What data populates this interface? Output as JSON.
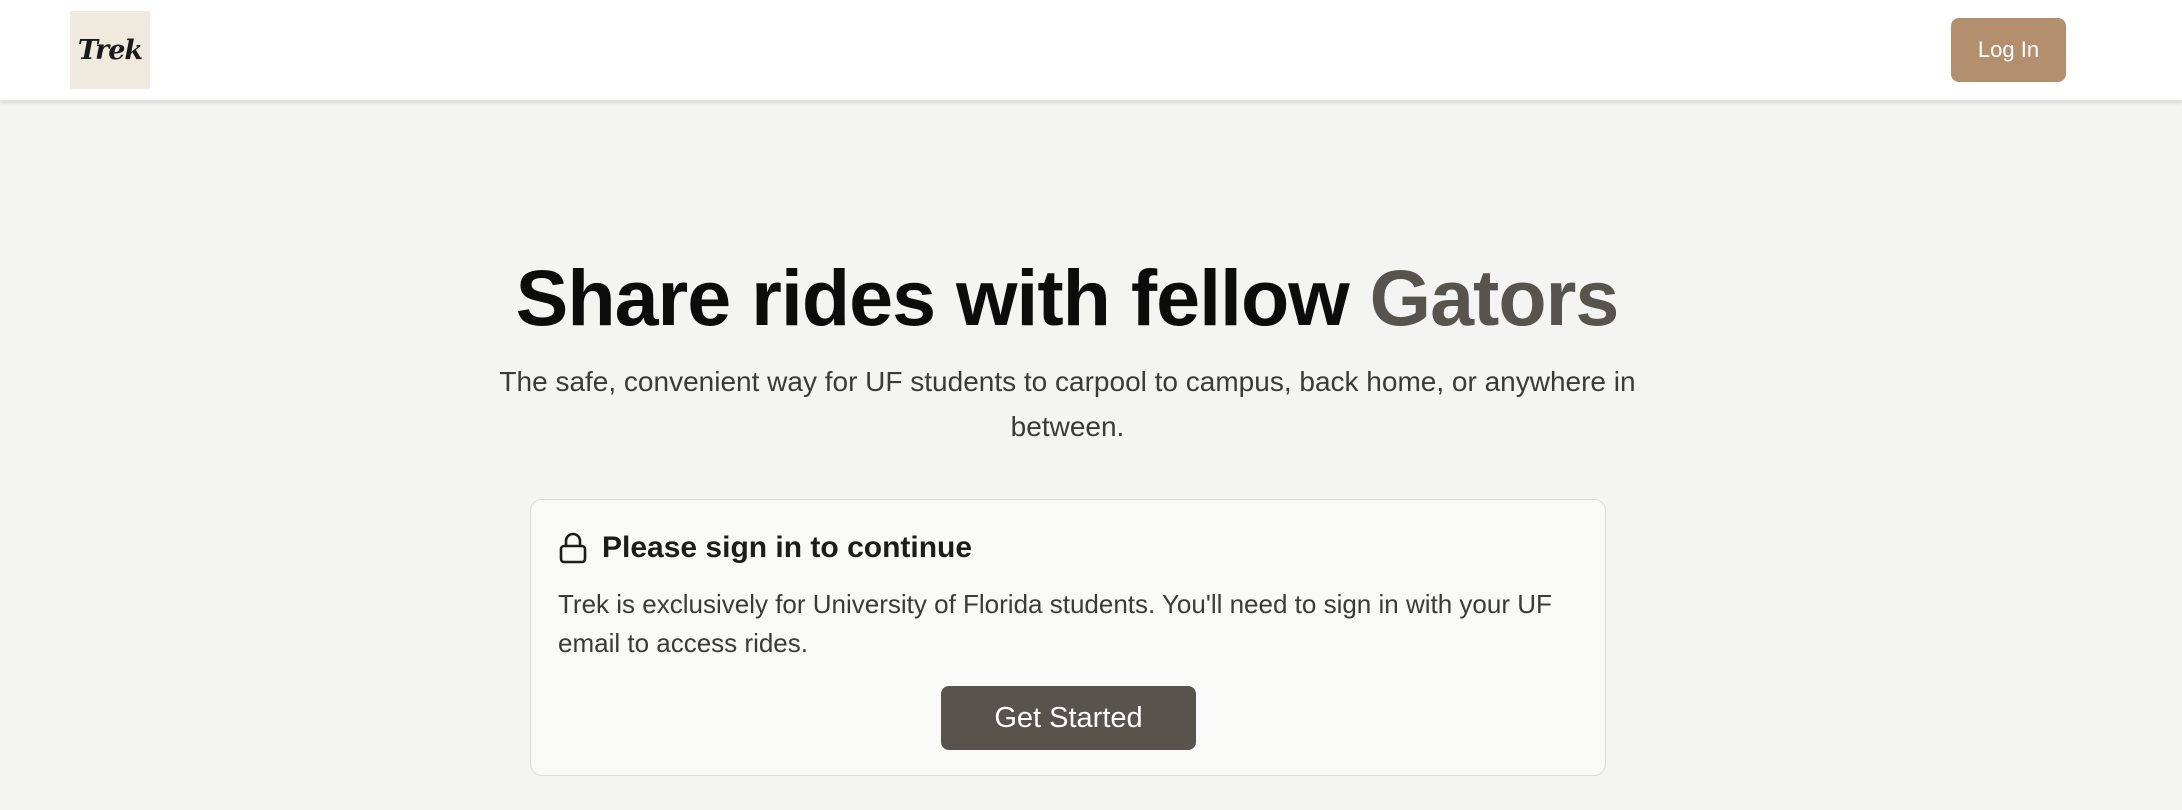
{
  "navbar": {
    "logo_text": "Trek",
    "login_label": "Log In"
  },
  "hero": {
    "title_main": "Share rides with fellow ",
    "title_accent": "Gators",
    "subtitle": "The safe, convenient way for UF students to carpool to campus, back home, or anywhere in between."
  },
  "signin_card": {
    "icon": "lock-icon",
    "title": "Please sign in to continue",
    "body": "Trek is exclusively for University of Florida students. You'll need to sign in with your UF email to access rides.",
    "cta_label": "Get Started"
  },
  "colors": {
    "background": "#f4f4f2",
    "accent_brown": "#b38f6d",
    "dark_button": "#57534d",
    "accent_text": "#57534d"
  }
}
